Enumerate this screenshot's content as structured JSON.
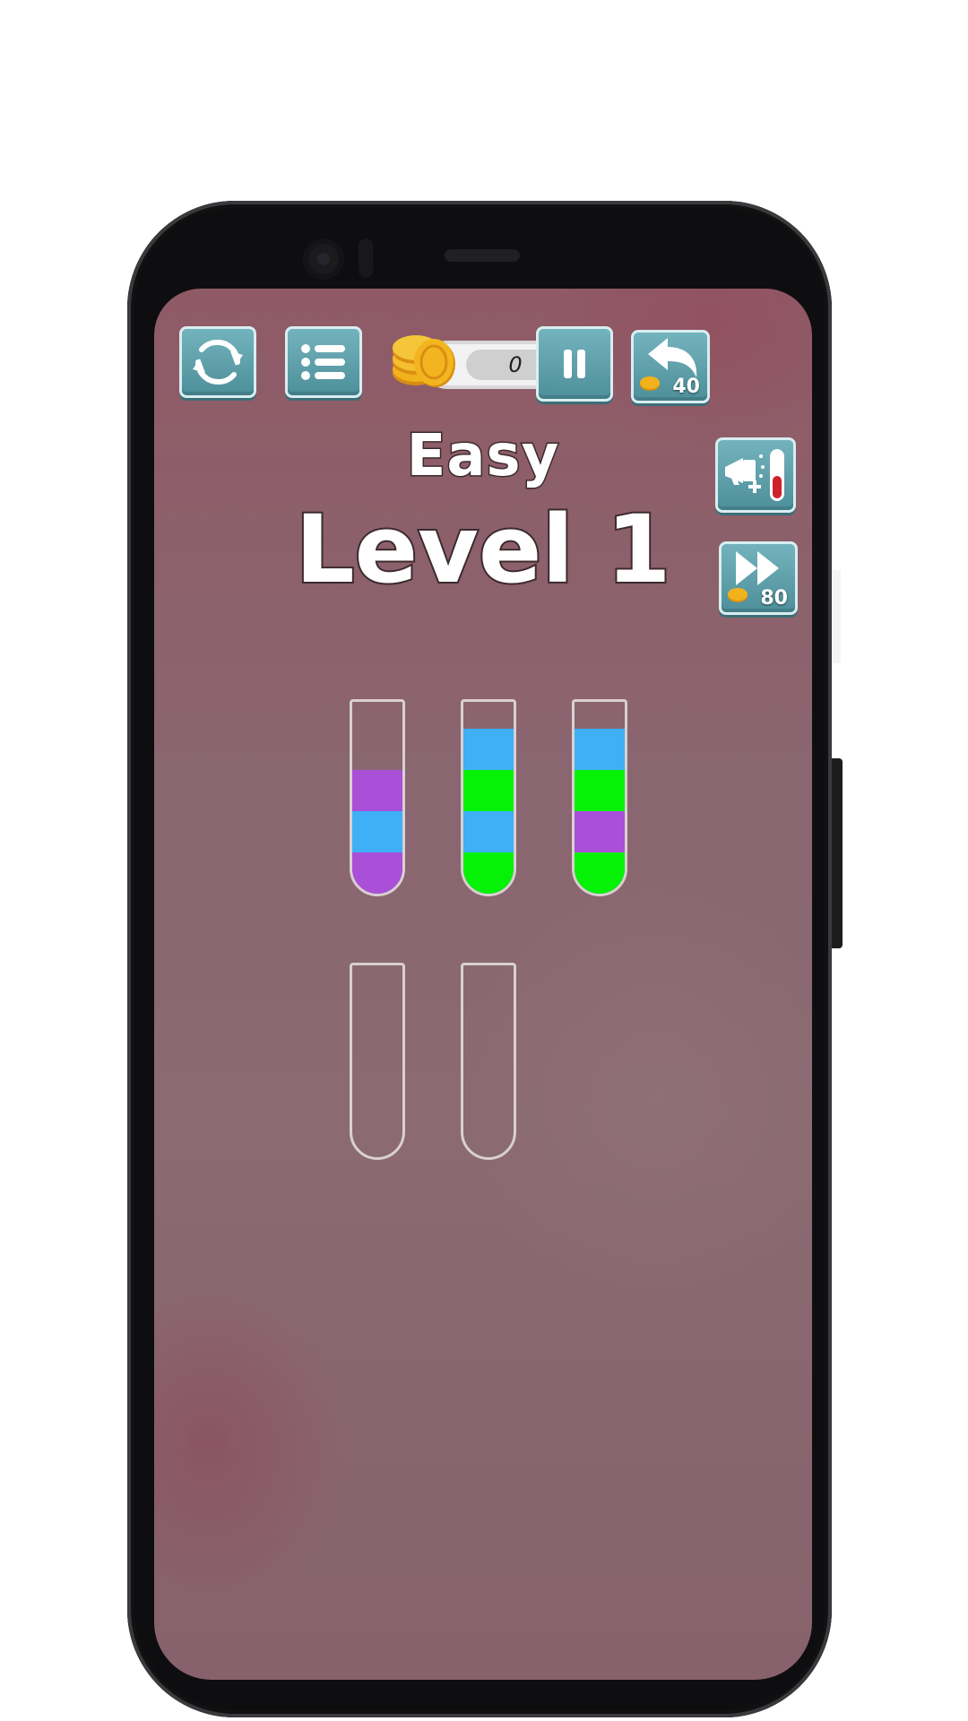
{
  "colors": {
    "purple": "#a94fd8",
    "blue": "#3fb0f6",
    "green": "#05f207",
    "button_teal": "#5e9fa9",
    "coin_gold": "#f1b21c"
  },
  "toolbar": {
    "restart_icon": "restart-icon",
    "menu_icon": "menu-list-icon",
    "pause_icon": "pause-icon",
    "undo_icon": "undo-icon",
    "add_tube_icon": "add-tube-icon",
    "skip_icon": "fast-forward-icon",
    "undo_cost": "40",
    "skip_cost": "80"
  },
  "coins": {
    "balance": "0",
    "icon": "coin-stack-icon"
  },
  "header": {
    "difficulty": "Easy",
    "level": "Level 1"
  },
  "tubes": [
    {
      "layers_bottom_to_top": [
        "purple",
        "blue",
        "purple"
      ]
    },
    {
      "layers_bottom_to_top": [
        "green",
        "blue",
        "green",
        "blue"
      ]
    },
    {
      "layers_bottom_to_top": [
        "green",
        "purple",
        "green",
        "blue"
      ]
    },
    {
      "layers_bottom_to_top": []
    },
    {
      "layers_bottom_to_top": []
    }
  ]
}
